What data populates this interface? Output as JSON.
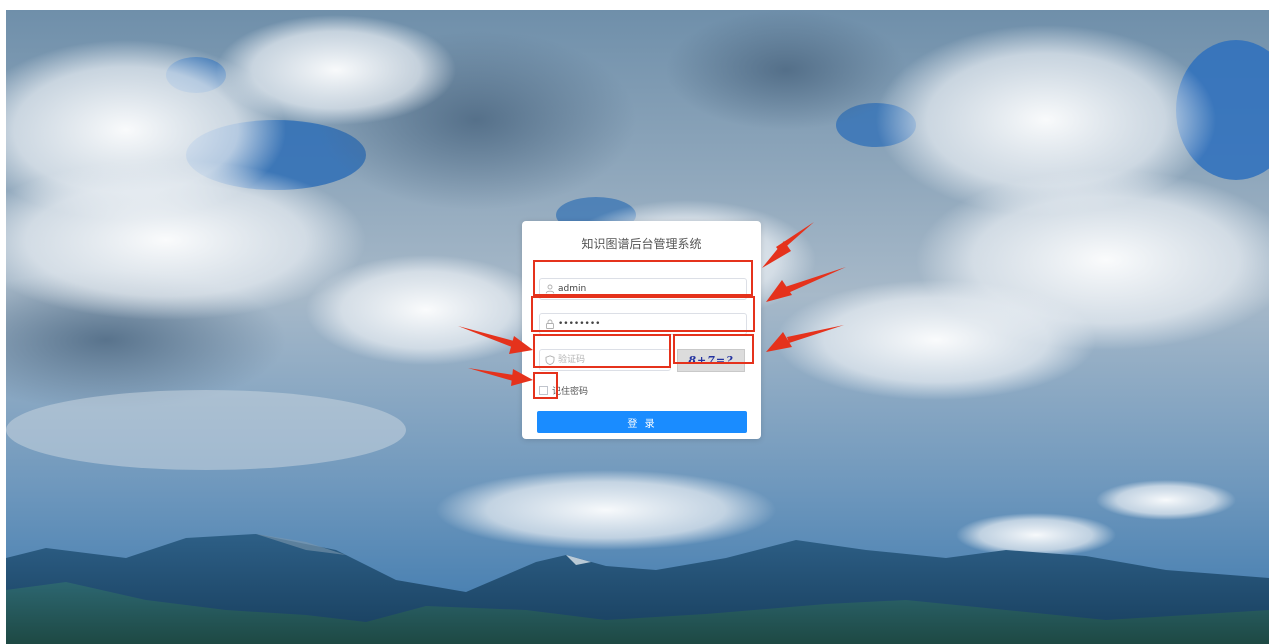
{
  "login": {
    "title": "知识图谱后台管理系统",
    "username_value": "admin",
    "password_value": "••••••••",
    "captcha_placeholder": "验证码",
    "captcha_image_text": "8+7=?",
    "remember_label": "记住密码",
    "remember_checked": false,
    "submit_label": "登 录"
  },
  "icons": {
    "username": "user-icon",
    "password": "lock-icon",
    "captcha": "shield-icon"
  },
  "colors": {
    "primary_button": "#1a8cff",
    "annotation": "#e5321c",
    "card_background": "#ffffff"
  }
}
